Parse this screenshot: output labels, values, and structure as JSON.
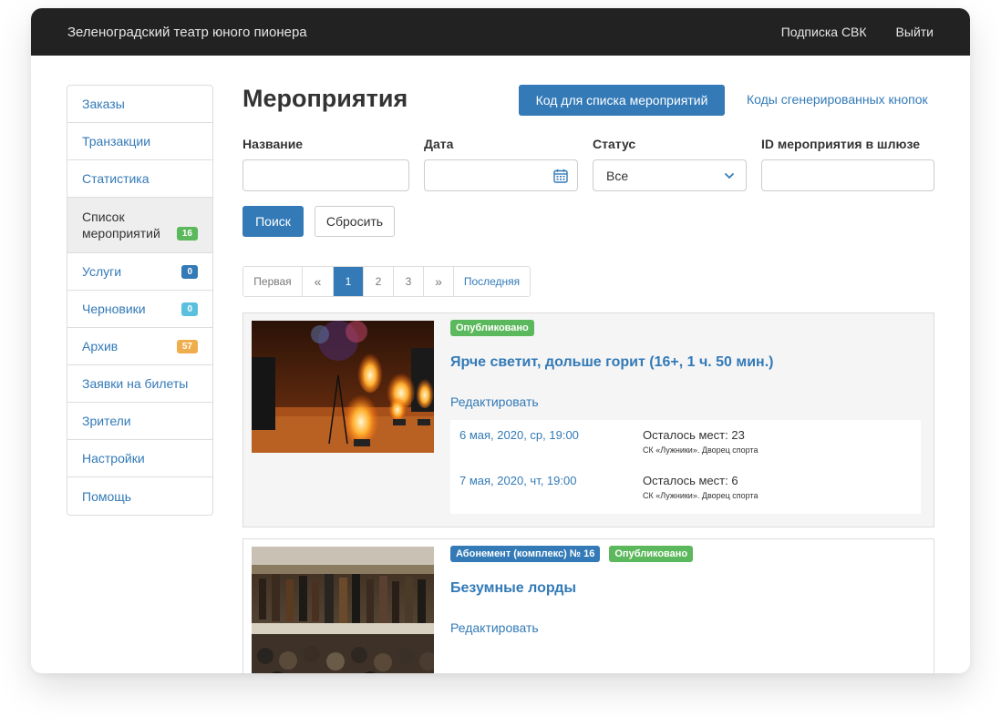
{
  "navbar": {
    "brand": "Зеленоградский театр юного пионера",
    "links": [
      "Подписка СВК",
      "Выйти"
    ]
  },
  "sidebar": {
    "items": [
      {
        "label": "Заказы"
      },
      {
        "label": "Транзакции"
      },
      {
        "label": "Статистика"
      },
      {
        "label": "Список мероприятий",
        "badge": "16",
        "badge_color": "#5cb85c",
        "active": true
      },
      {
        "label": "Услуги",
        "badge": "0",
        "badge_color": "#337ab7"
      },
      {
        "label": "Черновики",
        "badge": "0",
        "badge_color": "#5bc0de"
      },
      {
        "label": "Архив",
        "badge": "57",
        "badge_color": "#f0ad4e"
      },
      {
        "label": "Заявки на билеты"
      },
      {
        "label": "Зрители"
      },
      {
        "label": "Настройки"
      },
      {
        "label": "Помощь"
      }
    ]
  },
  "header": {
    "title": "Мероприятия",
    "code_button": "Код для списка мероприятий",
    "codes_link": "Коды сгенерированных кнопок"
  },
  "filters": {
    "name_label": "Название",
    "name_value": "",
    "date_label": "Дата",
    "date_value": "",
    "status_label": "Статус",
    "status_value": "Все",
    "gateway_label": "ID мероприятия в шлюзе",
    "gateway_value": "",
    "search_button": "Поиск",
    "reset_button": "Сбросить"
  },
  "pagination": {
    "first": "Первая",
    "prev": "«",
    "pages": [
      "1",
      "2",
      "3"
    ],
    "current": "1",
    "next": "»",
    "last": "Последняя"
  },
  "events": [
    {
      "labels": [
        {
          "text": "Опубликовано",
          "color": "#5cb85c"
        }
      ],
      "title": "Ярче светит, дольше горит (16+, 1 ч. 50 мин.)",
      "edit": "Редактировать",
      "sessions": [
        {
          "date": "6 мая, 2020, ср, 19:00",
          "seats": "Осталось мест: 23",
          "venue": "СК «Лужники». Дворец спорта"
        },
        {
          "date": "7 мая, 2020, чт, 19:00",
          "seats": "Осталось мест: 6",
          "venue": "СК «Лужники». Дворец спорта"
        }
      ]
    },
    {
      "labels": [
        {
          "text": "Абонемент (комплекс) № 16",
          "color": "#337ab7"
        },
        {
          "text": "Опубликовано",
          "color": "#5cb85c"
        }
      ],
      "title": "Безумные лорды",
      "edit": "Редактировать",
      "sessions": []
    }
  ],
  "colors": {
    "primary": "#337ab7",
    "navbar": "#222222",
    "success": "#5cb85c",
    "info": "#5bc0de",
    "warning": "#f0ad4e"
  },
  "icons": {
    "date_field": "calendar-icon",
    "status_select": "chevron-down-icon"
  }
}
